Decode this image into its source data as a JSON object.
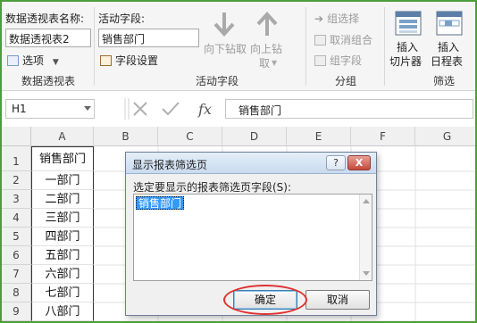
{
  "ribbon": {
    "pivot_name_label": "数据透视表名称:",
    "pivot_name_value": "数据透视表2",
    "options_label": "选项",
    "group_pivot_label": "数据透视表",
    "active_field_label": "活动字段:",
    "active_field_value": "销售部门",
    "field_settings_label": "字段设置",
    "drill_down_label": "向下钻取",
    "drill_up_label": "向上钻",
    "drill_up_label2": "取",
    "group_active_label": "活动字段",
    "group_selection_label": "组选择",
    "ungroup_label": "取消组合",
    "group_field_label": "组字段",
    "group_group_label": "分组",
    "insert_slicer_label1": "插入",
    "insert_slicer_label2": "切片器",
    "insert_timeline_label1": "插入",
    "insert_timeline_label2": "日程表",
    "group_filter_label": "筛选"
  },
  "formula_bar": {
    "name_box": "H1",
    "formula": "销售部门",
    "fx": "fx"
  },
  "columns": [
    "A",
    "B",
    "C",
    "D",
    "E",
    "F",
    "G"
  ],
  "rows": [
    "1",
    "2",
    "3",
    "4",
    "5",
    "6",
    "7",
    "8",
    "9"
  ],
  "cells_a": [
    "销售部门",
    "一部门",
    "二部门",
    "三部门",
    "四部门",
    "五部门",
    "六部门",
    "七部门",
    "八部门"
  ],
  "dialog": {
    "title": "显示报表筛选页",
    "help": "?",
    "close": "X",
    "prompt": "选定要显示的报表筛选页字段(S):",
    "list_item": "销售部门",
    "ok_label": "确定",
    "cancel_label": "取消"
  },
  "colors": {
    "accent": "#217346",
    "highlight_circle": "#e03030",
    "selection": "#3399ff"
  }
}
